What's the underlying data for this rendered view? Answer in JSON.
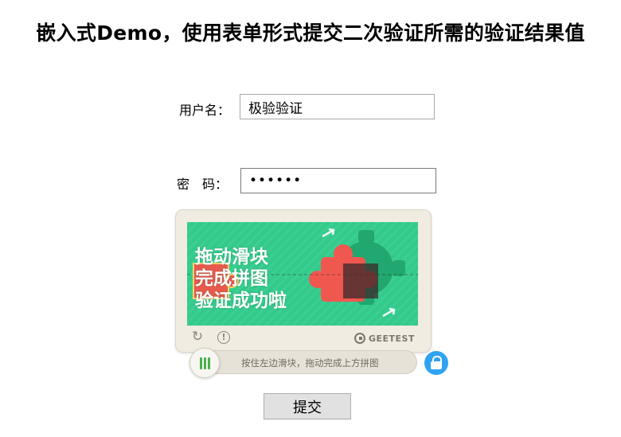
{
  "page": {
    "title": "嵌入式Demo，使用表单形式提交二次验证所需的验证结果值"
  },
  "form": {
    "username_label": "用户名：",
    "username_value": "极验验证",
    "password_label": "密　码：",
    "password_value": "123456",
    "submit_label": "提交"
  },
  "captcha": {
    "image_text": [
      "拖动滑块",
      "完成拼图",
      "验证成功啦"
    ],
    "brand": "GEETEST",
    "slider_hint": "按住左边滑块，拖动完成上方拼图",
    "colors": {
      "image_background": "#35c98b",
      "panel_background": "#f1ece2",
      "puzzle_red": "#f0584f",
      "lock_blue": "#2fa3f2",
      "grip_green": "#4caf50"
    },
    "icons": [
      "refresh-icon",
      "info-icon",
      "geetest-logo",
      "grip-icon",
      "lock-icon"
    ]
  }
}
